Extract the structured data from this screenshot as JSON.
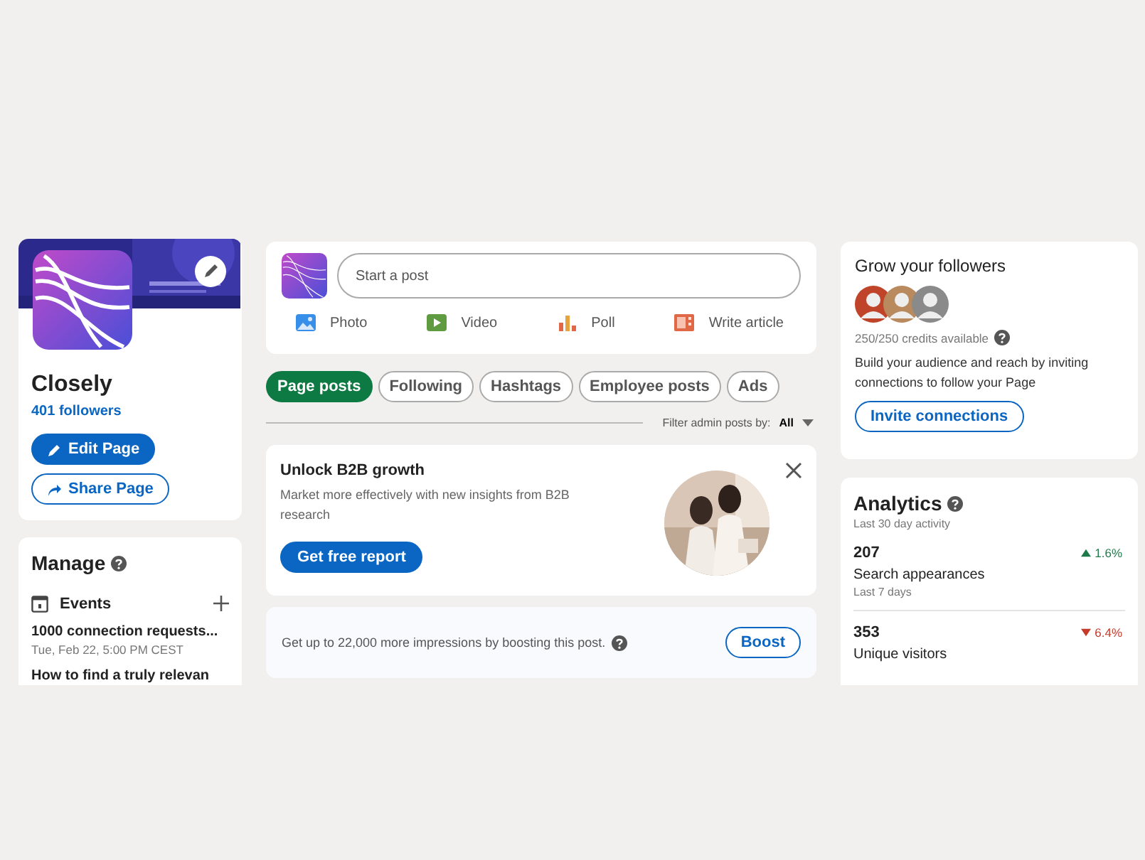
{
  "profile": {
    "name": "Closely",
    "followers": "401 followers",
    "buttons": [
      {
        "label": "Edit Page",
        "kind": "primary"
      },
      {
        "label": "Share Page",
        "kind": "secondary"
      }
    ]
  },
  "manage": {
    "title": "Manage",
    "sections": [
      {
        "label": "Events",
        "items": [
          {
            "title": "1000 connection requests...",
            "meta": "Tue, Feb 22, 5:00 PM CEST"
          },
          {
            "title": "How to find a truly relevan"
          }
        ]
      }
    ]
  },
  "composer": {
    "placeholder": "Start a post",
    "actions": [
      {
        "label": "Photo"
      },
      {
        "label": "Video",
        "kind": "video"
      },
      {
        "label": "Poll",
        "kind": "poll"
      },
      {
        "label": "Write article",
        "kind": "article"
      }
    ]
  },
  "filters": [
    {
      "label": "Page posts",
      "selected": true
    },
    {
      "label": "Following",
      "selected": false
    },
    {
      "label": "Hashtags",
      "selected": false
    },
    {
      "label": "Employee posts",
      "selected": false
    },
    {
      "label": "Ads",
      "selected": false
    }
  ],
  "filter_admin": {
    "label": "Filter admin posts by:",
    "value": "All"
  },
  "promo": {
    "title": "Unlock B2B growth",
    "text": "Market more effectively with new insights from B2B research",
    "button": "Get free report"
  },
  "boost": {
    "text": "Get up to 22,000 more impressions by boosting this post.",
    "button": "Boost"
  },
  "grow": {
    "title": "Grow your followers",
    "credits": "250/250 credits available",
    "text": "Build your audience and reach by inviting connections to follow your Page",
    "button": "Invite connections"
  },
  "analytics": {
    "title": "Analytics",
    "subtitle": "Last 30 day activity",
    "metrics": [
      {
        "value": "207",
        "label": "Search appearances",
        "period": "Last 7 days",
        "kind": "up",
        "change": "1.6%"
      },
      {
        "value": "353",
        "label": "Unique visitors",
        "kind": "down",
        "change": "6.4%"
      }
    ]
  }
}
